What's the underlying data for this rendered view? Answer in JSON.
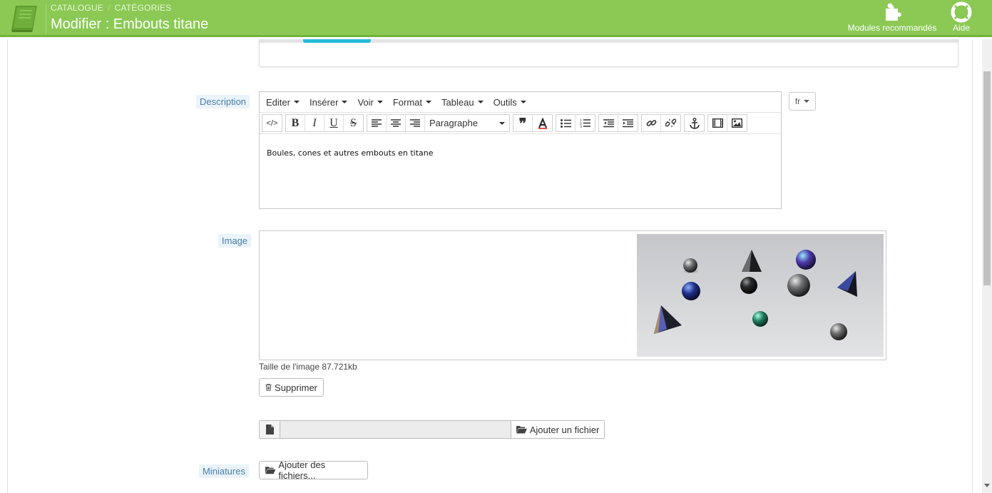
{
  "header": {
    "breadcrumb": [
      "CATALOGUE",
      "CATÉGORIES"
    ],
    "title": "Modifier : Embouts titane",
    "modules_label": "Modules recommandés",
    "help_label": "Aide"
  },
  "labels": {
    "description": "Description",
    "image": "Image",
    "miniatures": "Miniatures"
  },
  "editor": {
    "menus": [
      "Editer",
      "Insérer",
      "Voir",
      "Format",
      "Tableau",
      "Outils"
    ],
    "paragraph_select": "Paragraphe",
    "content": "Boules, cones et autres embouts en titane",
    "language": "fr"
  },
  "image": {
    "size_text": "Taille de l'image 87.721kb",
    "delete_label": "Supprimer",
    "add_file_label": "Ajouter un fichier"
  },
  "miniatures": {
    "add_files_label": "Ajouter des fichiers..."
  },
  "colors": {
    "header_bg": "#8bc954",
    "label_text": "#4a7fa6",
    "accent": "#25b9d7"
  }
}
